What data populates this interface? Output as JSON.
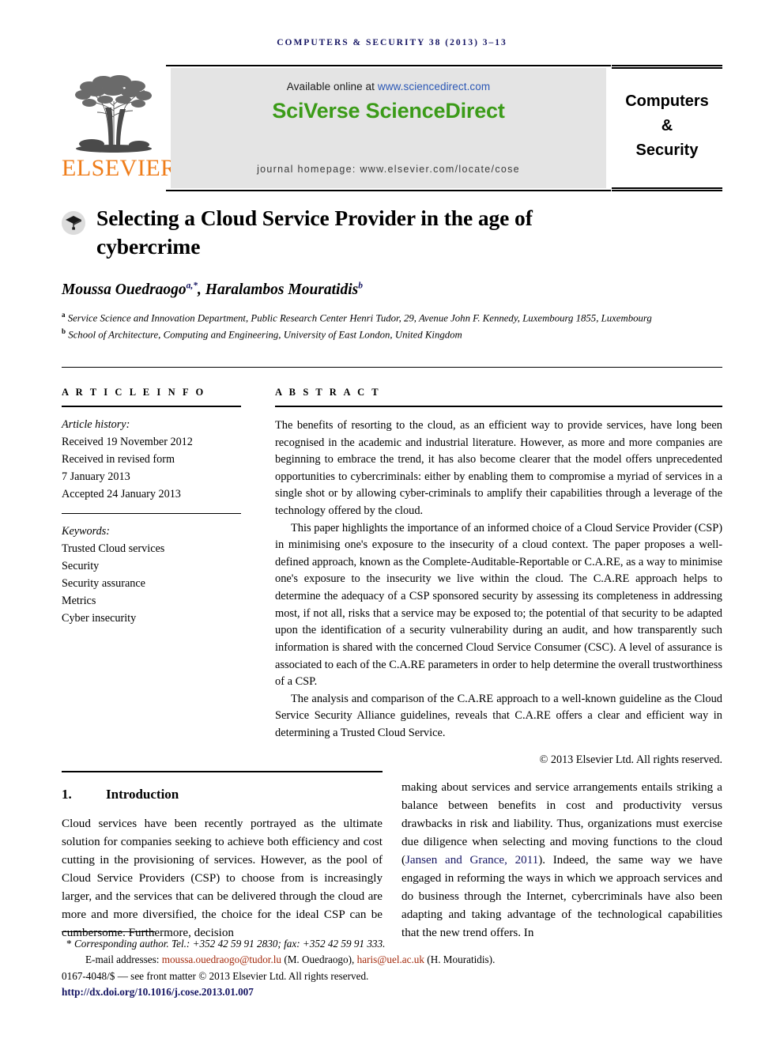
{
  "running_head": "COMPUTERS & SECURITY 38 (2013) 3–13",
  "masthead": {
    "publisher_wordmark": "ELSEVIER",
    "available_prefix": "Available online at ",
    "available_url": "www.sciencedirect.com",
    "platform_title": "SciVerse ScienceDirect",
    "homepage_line": "journal homepage: www.elsevier.com/locate/cose",
    "journal_name_line1": "Computers",
    "journal_name_line2": "&",
    "journal_name_line3": "Security",
    "colors": {
      "elsevier_orange": "#ef7d1a",
      "sciencedirect_green": "#3b9b18",
      "link_blue": "#2b57b5",
      "running_head_navy": "#151563",
      "box_gray": "#e4e4e4"
    }
  },
  "article": {
    "crossmark_icon": "graduation-cap-icon",
    "title": "Selecting a Cloud Service Provider in the age of cybercrime",
    "authors_html": "Moussa Ouedraogo<sup>a,*</sup>, Haralambos Mouratidis<sup>b</sup>",
    "affiliations": [
      {
        "marker": "a",
        "text": "Service Science and Innovation Department, Public Research Center Henri Tudor, 29, Avenue John F. Kennedy, Luxembourg 1855, Luxembourg"
      },
      {
        "marker": "b",
        "text": "School of Architecture, Computing and Engineering, University of East London, United Kingdom"
      }
    ]
  },
  "article_info": {
    "heading": "A R T I C L E  I N F O",
    "history_label": "Article history:",
    "history": [
      "Received 19 November 2012",
      "Received in revised form",
      "7 January 2013",
      "Accepted 24 January 2013"
    ],
    "keywords_label": "Keywords:",
    "keywords": [
      "Trusted Cloud services",
      "Security",
      "Security assurance",
      "Metrics",
      "Cyber insecurity"
    ]
  },
  "abstract": {
    "heading": "A B S T R A C T",
    "paragraphs": [
      "The benefits of resorting to the cloud, as an efficient way to provide services, have long been recognised in the academic and industrial literature. However, as more and more companies are beginning to embrace the trend, it has also become clearer that the model offers unprecedented opportunities to cybercriminals: either by enabling them to compromise a myriad of services in a single shot or by allowing cyber-criminals to amplify their capabilities through a leverage of the technology offered by the cloud.",
      "This paper highlights the importance of an informed choice of a Cloud Service Provider (CSP) in minimising one's exposure to the insecurity of a cloud context. The paper proposes a well-defined approach, known as the Complete-Auditable-Reportable or C.A.RE, as a way to minimise one's exposure to the insecurity we live within the cloud. The C.A.RE approach helps to determine the adequacy of a CSP sponsored security by assessing its completeness in addressing most, if not all, risks that a service may be exposed to; the potential of that security to be adapted upon the identification of a security vulnerability during an audit, and how transparently such information is shared with the concerned Cloud Service Consumer (CSC). A level of assurance is associated to each of the C.A.RE parameters in order to help determine the overall trustworthiness of a CSP.",
      "The analysis and comparison of the C.A.RE approach to a well-known guideline as the Cloud Service Security Alliance guidelines, reveals that C.A.RE offers a clear and efficient way in determining a Trusted Cloud Service."
    ],
    "copyright": "© 2013 Elsevier Ltd. All rights reserved."
  },
  "body": {
    "section_number": "1.",
    "section_title": "Introduction",
    "left_column": "Cloud services have been recently portrayed as the ultimate solution for companies seeking to achieve both efficiency and cost cutting in the provisioning of services. However, as the pool of Cloud Service Providers (CSP) to choose from is increasingly larger, and the services that can be delivered through the cloud are more and more diversified, the choice for the ideal CSP can be cumbersome. Furthermore, decision",
    "right_column_pre": "making about services and service arrangements entails striking a balance between benefits in cost and productivity versus drawbacks in risk and liability. Thus, organizations must exercise due diligence when selecting and moving functions to the cloud (",
    "right_column_citation": "Jansen and Grance, 2011",
    "right_column_post": "). Indeed, the same way we have engaged in reforming the ways in which we approach services and do business through the Internet, cybercriminals have also been adapting and taking advantage of the technological capabilities that the new trend offers. In"
  },
  "footnote": {
    "star": "*",
    "corresponding": "Corresponding author. Tel.: +352 42 59 91 2830; fax: +352 42 59 91 333.",
    "email_label": "E-mail addresses:",
    "email1": "moussa.ouedraogo@tudor.lu",
    "email1_owner": "(M. Ouedraogo),",
    "email2": "haris@uel.ac.uk",
    "email2_owner": "(H. Mouratidis).",
    "front_matter": "0167-4048/$ — see front matter © 2013 Elsevier Ltd. All rights reserved.",
    "doi": "http://dx.doi.org/10.1016/j.cose.2013.01.007"
  }
}
